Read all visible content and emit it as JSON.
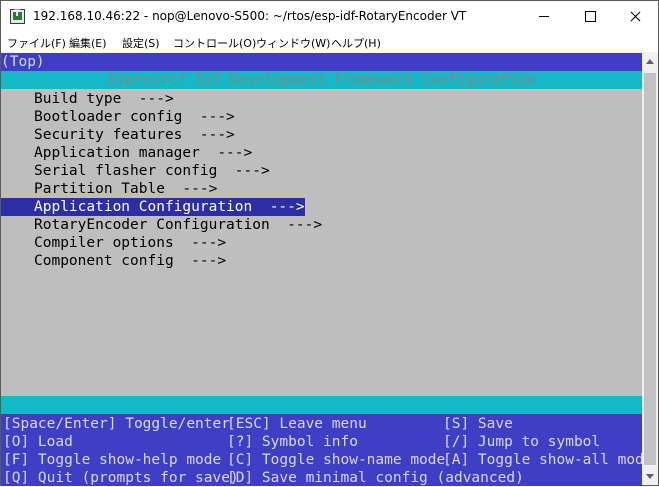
{
  "window": {
    "title": "192.168.10.46:22 - nop@Lenovo-S500: ~/rtos/esp-idf-RotaryEncoder VT"
  },
  "menubar": {
    "items": [
      "ファイル(F)",
      "編集(E)",
      "設定(S)",
      "コントロール(O)",
      "ウィンドウ(W)",
      "ヘルプ(H)"
    ]
  },
  "terminal": {
    "breadcrumb": "(Top)",
    "header": "Espressif IoT Development Framework Configuration",
    "options": [
      "Build type  --->",
      "Bootloader config  --->",
      "Security features  --->",
      "Application manager  --->",
      "Serial flasher config  --->",
      "Partition Table  --->",
      "Application Configuration  --->",
      "RotaryEncoder Configuration  --->",
      "Compiler options  --->",
      "Component config  --->"
    ],
    "selected_index": 6,
    "hotkeys": [
      [
        "[Space/Enter] Toggle/enter",
        "[ESC] Leave menu",
        "[S] Save"
      ],
      [
        "[O] Load",
        "[?] Symbol info",
        "[/] Jump to symbol"
      ],
      [
        "[F] Toggle show-help mode",
        "[C] Toggle show-name mode",
        "[A] Toggle show-all mode"
      ],
      [
        "[Q] Quit (prompts for save)",
        "[D] Save minimal config (advanced)",
        ""
      ]
    ]
  },
  "colors": {
    "terminal_bg": "#bebebe",
    "bar_blue": "#3f3fc6",
    "header_cyan": "#14b8c6",
    "selection": "#2e2ea4"
  }
}
